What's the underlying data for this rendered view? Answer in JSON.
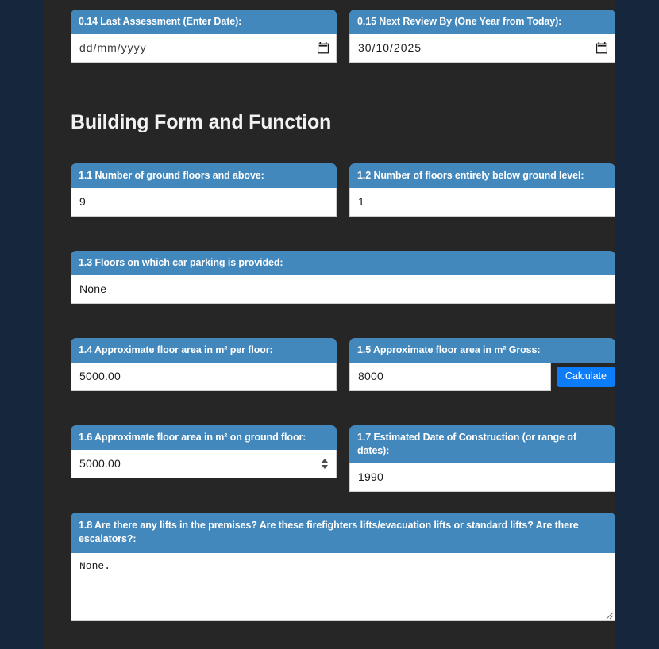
{
  "theme": {
    "page_background": "#15263d",
    "container_background": "#262626",
    "label_header_blue": "#4388bd",
    "button_blue": "#0d7cf8",
    "input_background": "#ffffff",
    "text_light": "#f2f2f2",
    "text_dark": "#1b1b1b"
  },
  "section_heading": "Building Form and Function",
  "fields": {
    "f0_14": {
      "label": "0.14 Last Assessment (Enter Date):",
      "value": "",
      "placeholder": "dd/mm/yyyy",
      "type": "date",
      "icon": "calendar-icon"
    },
    "f0_15": {
      "label": "0.15 Next Review By (One Year from Today):",
      "value": "30/10/2025",
      "placeholder": "dd/mm/yyyy",
      "type": "date",
      "icon": "calendar-icon"
    },
    "f1_1": {
      "label": "1.1 Number of ground floors and above:",
      "value": "9",
      "type": "text"
    },
    "f1_2": {
      "label": "1.2 Number of floors entirely below ground level:",
      "value": "1",
      "type": "text"
    },
    "f1_3": {
      "label": "1.3 Floors on which car parking is provided:",
      "value": "None",
      "type": "text"
    },
    "f1_4": {
      "label": "1.4 Approximate floor area in m² per floor:",
      "value": "5000.00",
      "type": "text"
    },
    "f1_5": {
      "label": "1.5 Approximate floor area in m² Gross:",
      "value": "8000",
      "type": "text",
      "button_label": "Calculate"
    },
    "f1_6": {
      "label": "1.6 Approximate floor area in m² on ground floor:",
      "value": "5000.00",
      "type": "number",
      "icon": "spinner-arrows-icon"
    },
    "f1_7": {
      "label": "1.7 Estimated Date of Construction (or range of dates):",
      "value": "1990",
      "type": "text"
    },
    "f1_8": {
      "label": "1.8 Are there any lifts in the premises? Are these firefighters lifts/evacuation lifts or standard lifts? Are there escalators?:",
      "value": "None.",
      "type": "textarea"
    }
  }
}
